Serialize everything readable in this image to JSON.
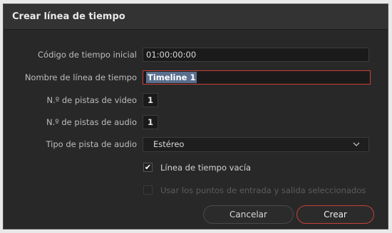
{
  "dialog": {
    "title": "Crear línea de tiempo"
  },
  "fields": {
    "timecode": {
      "label": "Código de tiempo inicial",
      "value": "01:00:00:00"
    },
    "name": {
      "label": "Nombre de línea de tiempo",
      "value": "Timeline 1"
    },
    "video_tracks": {
      "label": "N.º de pistas de video",
      "value": "1"
    },
    "audio_tracks": {
      "label": "N.º de pistas de audio",
      "value": "1"
    },
    "audio_type": {
      "label": "Tipo de pista de audio",
      "value": "Estéreo"
    }
  },
  "options": {
    "empty_timeline": {
      "label": "Línea de tiempo vacía",
      "checked": true,
      "check_glyph": "✔"
    },
    "use_in_out": {
      "label": "Usar los puntos de entrada y salida seleccionados",
      "checked": false,
      "disabled": true
    }
  },
  "buttons": {
    "cancel": "Cancelar",
    "create": "Crear"
  },
  "icons": {
    "dropdown": "chevron-down-icon",
    "checkbox": "checkmark-icon"
  },
  "colors": {
    "accent": "#c9403a",
    "selection": "#5a6f8e",
    "background": "#282828"
  }
}
